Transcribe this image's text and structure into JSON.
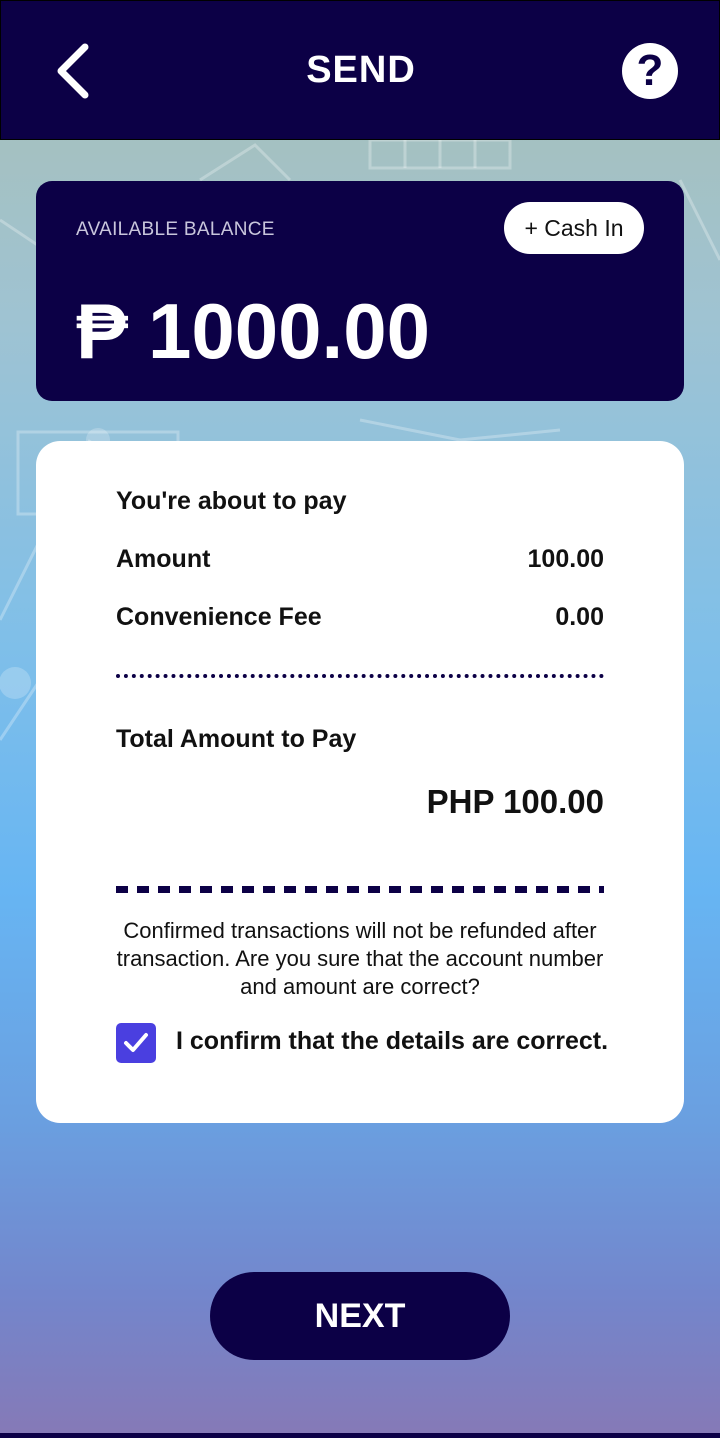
{
  "header": {
    "title": "SEND",
    "back_icon": "chevron-left-icon",
    "help_icon": "question-circle-icon",
    "help_glyph": "?"
  },
  "balance": {
    "label": "AVAILABLE BALANCE",
    "cash_in_label": "+ Cash In",
    "currency_symbol": "₱",
    "amount": "1000.00"
  },
  "details": {
    "heading": "You're about to pay",
    "amount_label": "Amount",
    "amount_value": "100.00",
    "fee_label": "Convenience Fee",
    "fee_value": "0.00",
    "total_label": "Total Amount to Pay",
    "total_value": "PHP 100.00",
    "warning": "Confirmed transactions will not be refunded after transaction. Are you sure that the account number and amount are correct?",
    "confirm_label": "I confirm that the details are correct.",
    "confirm_checked": true
  },
  "footer": {
    "next_label": "NEXT"
  },
  "colors": {
    "primary": "#0c0046",
    "checkbox": "#4a3fe0",
    "card": "#ffffff"
  }
}
